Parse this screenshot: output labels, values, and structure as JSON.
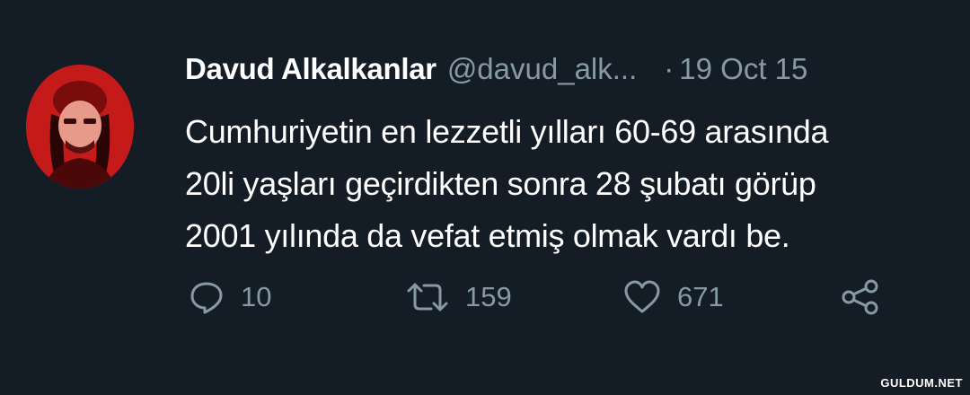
{
  "tweet": {
    "author_name": "Davud Alkalkanlar",
    "handle": "@davud_alk...",
    "separator": "·",
    "timestamp": "19 Oct 15",
    "lines": [
      "Cumhuriyetin en lezzetli yılları 60-69 arasında",
      "20li yaşları geçirdikten sonra 28 şubatı görüp",
      "2001 yılında da vefat etmiş olmak vardı be."
    ],
    "actions": {
      "reply_count": "10",
      "retweet_count": "159",
      "like_count": "671"
    }
  },
  "watermark": "GULDUM.NET",
  "icons": {
    "reply": "reply-icon",
    "retweet": "retweet-icon",
    "like": "heart-icon",
    "share": "share-icon"
  },
  "colors": {
    "background": "#141d26",
    "text": "#ffffff",
    "secondary": "#8899a6",
    "avatar_red": "#c41a1a"
  }
}
